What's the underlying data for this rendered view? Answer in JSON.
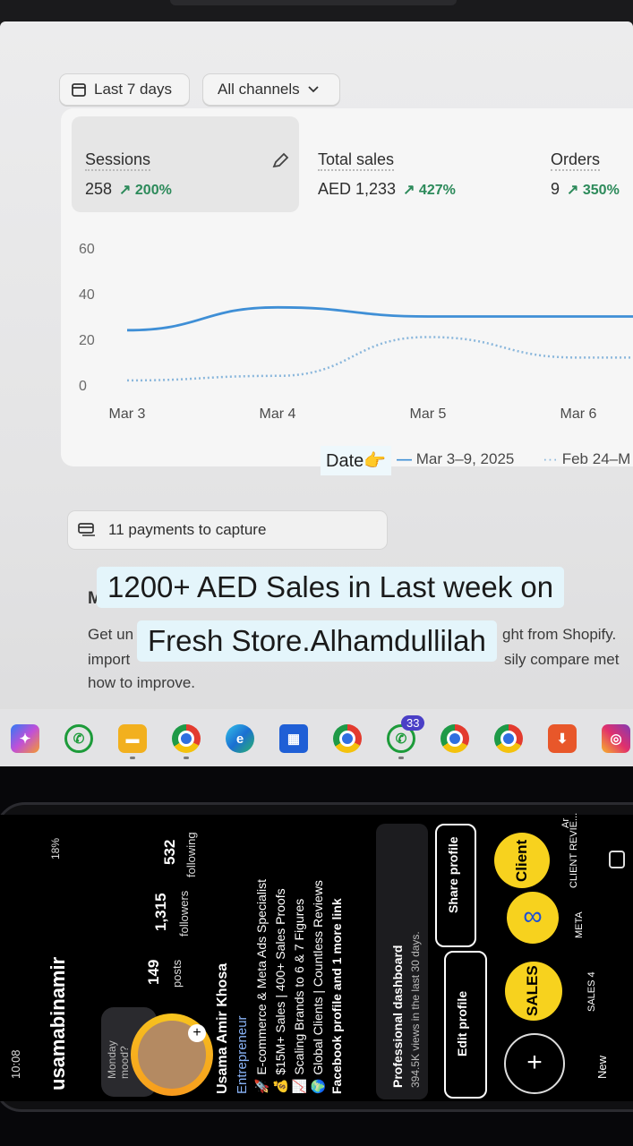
{
  "filters": {
    "date_range": "Last 7 days",
    "channels": "All channels"
  },
  "metrics": [
    {
      "label": "Sessions",
      "value": "258",
      "delta": "200%"
    },
    {
      "label": "Total sales",
      "value": "AED 1,233",
      "delta": "427%"
    },
    {
      "label": "Orders",
      "value": "9",
      "delta": "350%"
    }
  ],
  "chart_data": {
    "type": "line",
    "y_ticks": [
      "60",
      "40",
      "20",
      "0"
    ],
    "categories": [
      "Mar 3",
      "Mar 4",
      "Mar 5",
      "Mar 6"
    ],
    "ylim": [
      0,
      60
    ],
    "series": [
      {
        "name": "Mar 3–9, 2025",
        "style": "solid",
        "color": "#3f8fd6",
        "values": [
          24,
          34,
          30,
          30
        ]
      },
      {
        "name": "Feb 24–M",
        "style": "dotted",
        "color": "#8ab7dc",
        "values": [
          2,
          4,
          21,
          12
        ]
      }
    ],
    "legend": {
      "prefix": "Date👉",
      "current": "Mar 3–9, 2025",
      "previous": "Feb 24–M"
    }
  },
  "payments": {
    "label": "11 payments to capture"
  },
  "bottom_card": {
    "heading_fragment": "M",
    "line1_left": "Get un",
    "line1_right": "ght from Shopify.",
    "line2_left": "import",
    "line2_right": "sily compare met",
    "line3": "how to improve."
  },
  "overlay_caption": {
    "line1": "1200+ AED Sales in Last week on",
    "line2": "Fresh Store.Alhamdullilah"
  },
  "taskbar": {
    "badge_count": "33",
    "icons": [
      "copilot-icon",
      "whatsapp-icon",
      "file-explorer-icon",
      "chrome-icon",
      "edge-icon",
      "store-icon",
      "chrome-profile-icon",
      "whatsapp-icon",
      "chrome-icon",
      "chrome-icon",
      "download-icon",
      "instagram-icon"
    ]
  },
  "phone": {
    "status_time": "10:08",
    "battery": "18%",
    "username": "usamabinamir",
    "note_bubble": "Monday mood?",
    "stats": [
      {
        "value": "149",
        "label": "posts"
      },
      {
        "value": "1,315",
        "label": "followers"
      },
      {
        "value": "532",
        "label": "following"
      }
    ],
    "name": "Usama Amir Khosa",
    "category": "Entrepreneur",
    "bio": [
      "🚀 E-commerce & Meta Ads Specialist",
      "💰 $15M+ Sales | 400+ Sales Proofs",
      "📈 Scaling Brands to 6 & 7 Figures",
      "🌍 Global Clients | Countless Reviews",
      "Facebook profile and 1 more link"
    ],
    "dashboard_title": "Professional dashboard",
    "dashboard_sub": "394.5K views in the last 30 days.",
    "edit_profile": "Edit profile",
    "share_profile": "Share profile",
    "highlights": [
      {
        "label": "New",
        "text": "+"
      },
      {
        "label": "SALES 4",
        "text": "SALES"
      },
      {
        "label": "META",
        "text": "∞"
      },
      {
        "label": "CLIENT REVIE...",
        "text": "Client"
      },
      {
        "label": "Ar",
        "text": ""
      }
    ]
  }
}
